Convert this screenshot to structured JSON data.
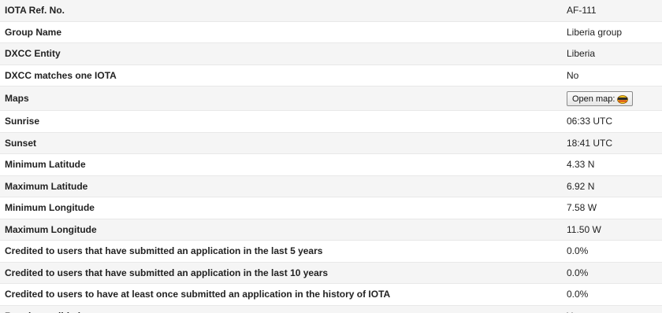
{
  "rows": [
    {
      "label": "IOTA Ref. No.",
      "value": "AF-111"
    },
    {
      "label": "Group Name",
      "value": "Liberia group"
    },
    {
      "label": "DXCC Entity",
      "value": "Liberia"
    },
    {
      "label": "DXCC matches one IOTA",
      "value": "No"
    },
    {
      "label": "Maps",
      "button_label": "Open map:",
      "button_icon": "map-logo-icon"
    },
    {
      "label": "Sunrise",
      "value": "06:33 UTC"
    },
    {
      "label": "Sunset",
      "value": "18:41 UTC"
    },
    {
      "label": "Minimum Latitude",
      "value": "4.33 N"
    },
    {
      "label": "Maximum Latitude",
      "value": "6.92 N"
    },
    {
      "label": "Minimum Longitude",
      "value": "7.58 W"
    },
    {
      "label": "Maximum Longitude",
      "value": "11.50 W"
    },
    {
      "label": "Credited to users that have submitted an application in the last 5 years",
      "value": "0.0%"
    },
    {
      "label": "Credited to users that have submitted an application in the last 10 years",
      "value": "0.0%"
    },
    {
      "label": "Credited to users to have at least once submitted an application in the history of IOTA",
      "value": "0.0%"
    },
    {
      "label": "Requires validation",
      "value": "Yes"
    }
  ]
}
